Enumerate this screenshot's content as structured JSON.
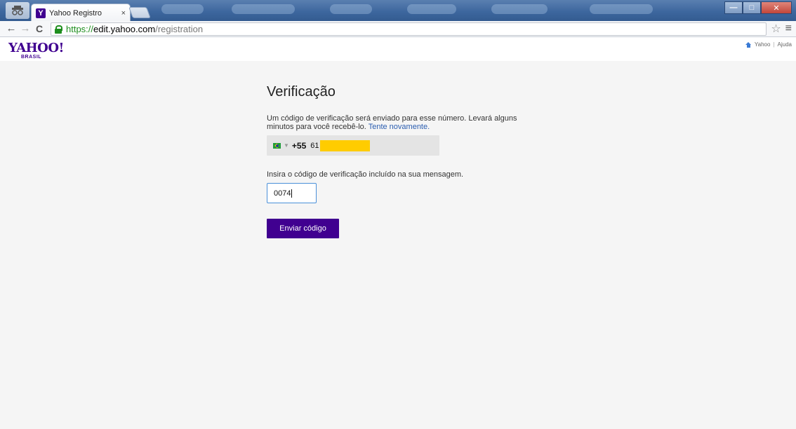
{
  "browser": {
    "tab_title": "Yahoo Registro",
    "tab_close": "×",
    "url_scheme": "https://",
    "url_host": "edit.yahoo.com",
    "url_path": "/registration",
    "win_min": "—",
    "win_max": "□",
    "win_close": "✕"
  },
  "header": {
    "logo": "YAHOO!",
    "logo_sub": "BRASIL",
    "links": [
      "Yahoo",
      "|",
      "Ajuda"
    ]
  },
  "main": {
    "title": "Verificação",
    "description": "Um código de verificação será enviado para esse número. Levará alguns minutos para você recebê-lo.",
    "retry_link": "Tente novamente.",
    "phone": {
      "country_code": "+55",
      "number_prefix": "61"
    },
    "code_label": "Insira o código de verificação incluído na sua mensagem.",
    "code_value": "0074",
    "submit_label": "Enviar código"
  },
  "colors": {
    "brand": "#400090",
    "link": "#2a5db0",
    "redaction": "#ffcc00"
  }
}
